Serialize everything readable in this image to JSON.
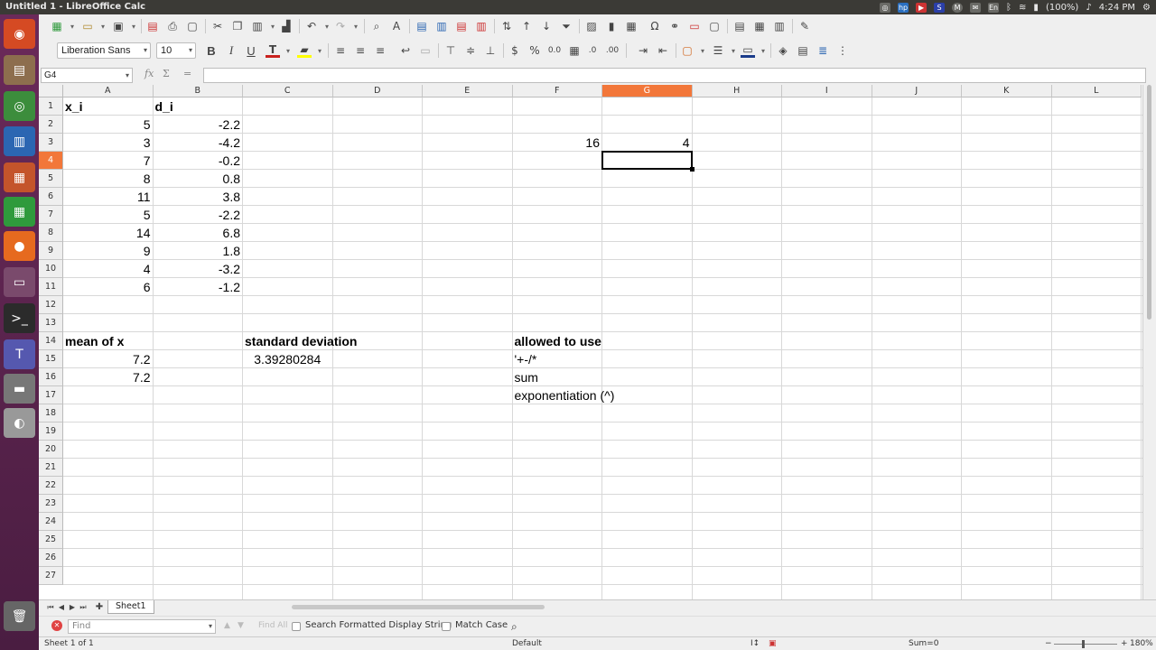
{
  "window": {
    "title": "Untitled 1 - LibreOffice Calc"
  },
  "system_tray": {
    "battery": "(100%)",
    "clock": "4:24 PM",
    "keyboard": "En"
  },
  "launcher": {
    "items": [
      {
        "name": "ubuntu-dash-icon",
        "glyph": "◉",
        "color": "#d54a23"
      },
      {
        "name": "files-icon",
        "glyph": "▤",
        "color": "#8d6e4e"
      },
      {
        "name": "chrome-icon",
        "glyph": "◎",
        "color": "#3c8d3c"
      },
      {
        "name": "writer-icon",
        "glyph": "▥",
        "color": "#2b66b2"
      },
      {
        "name": "impress-icon",
        "glyph": "▦",
        "color": "#c4542b"
      },
      {
        "name": "calc-icon",
        "glyph": "▦",
        "color": "#2f9a3c"
      },
      {
        "name": "firefox-icon",
        "glyph": "●",
        "color": "#e66a1f"
      },
      {
        "name": "workspace-icon",
        "glyph": "▭",
        "color": "#7a4a6c"
      },
      {
        "name": "terminal-icon",
        "glyph": ">_",
        "color": "#2b2b2b"
      },
      {
        "name": "teams-icon",
        "glyph": "T",
        "color": "#5558af"
      },
      {
        "name": "scanner-icon",
        "glyph": "▬",
        "color": "#777777"
      },
      {
        "name": "disk-icon",
        "glyph": "◐",
        "color": "#999999"
      },
      {
        "name": "trash-icon",
        "glyph": "🗑",
        "color": "#666666"
      }
    ]
  },
  "format_bar": {
    "font_name": "Liberation Sans",
    "font_size": "10",
    "bold": "B",
    "italic": "I",
    "underline": "U",
    "currency": "$",
    "percent": "%",
    "decimal": "0.0"
  },
  "formula_bar": {
    "name_box": "G4",
    "fx": "fx",
    "sum": "Σ",
    "equals": "=",
    "content": ""
  },
  "sheet": {
    "columns": [
      "A",
      "B",
      "C",
      "D",
      "E",
      "F",
      "G",
      "H",
      "I",
      "J",
      "K",
      "L"
    ],
    "rows": [
      "1",
      "2",
      "3",
      "4",
      "5",
      "6",
      "7",
      "8",
      "9",
      "10",
      "11",
      "12",
      "13",
      "14",
      "15",
      "16",
      "17",
      "18",
      "19",
      "20",
      "21",
      "22",
      "23",
      "24",
      "25",
      "26",
      "27"
    ],
    "selected_column": "G",
    "selected_row": "4",
    "cells": {
      "A1": "x_i",
      "B1": "d_i",
      "A2": "5",
      "B2": "-2.2",
      "A3": "3",
      "B3": "-4.2",
      "F3": "16",
      "G3": "4",
      "A4": "7",
      "B4": "-0.2",
      "A5": "8",
      "B5": "0.8",
      "A6": "11",
      "B6": "3.8",
      "A7": "5",
      "B7": "-2.2",
      "A8": "14",
      "B8": "6.8",
      "A9": "9",
      "B9": "1.8",
      "A10": "4",
      "B10": "-3.2",
      "A11": "6",
      "B11": "-1.2",
      "A14": "mean of x",
      "C14": "standard deviation",
      "F14": "allowed to use",
      "A15": "7.2",
      "C15": "3.39280284",
      "F15": "'+-/*",
      "A16": "7.2",
      "F16": "sum",
      "F17": "exponentiation (^)"
    }
  },
  "sheet_tabs": {
    "tabs": [
      "Sheet1"
    ]
  },
  "find_bar": {
    "placeholder": "Find",
    "find_all": "Find All",
    "search_formatted": "Search Formatted Display String",
    "match_case": "Match Case"
  },
  "status_bar": {
    "sheet_info": "Sheet 1 of 1",
    "page_style": "Default",
    "sum": "Sum=0",
    "zoom": "180%"
  }
}
